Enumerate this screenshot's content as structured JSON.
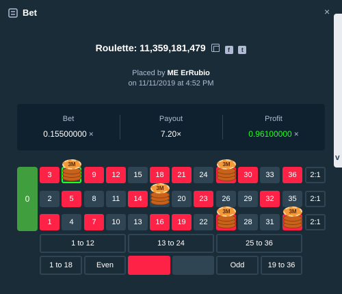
{
  "header": {
    "title": "Bet",
    "close_label": "×"
  },
  "game": {
    "title": "Roulette: 11,359,181,479"
  },
  "placed": {
    "prefix": "Placed by",
    "user": "ME ErRubio",
    "date": "on 11/11/2019 at 4:52 PM"
  },
  "stats": {
    "bet": {
      "label": "Bet",
      "value": "0.15500000",
      "currency_icon": "×"
    },
    "payout": {
      "label": "Payout",
      "value": "7.20×"
    },
    "profit": {
      "label": "Profit",
      "value": "0.96100000",
      "currency_icon": "×"
    }
  },
  "table": {
    "zero": "0",
    "rows": [
      [
        "3",
        "6",
        "9",
        "12",
        "15",
        "18",
        "21",
        "24",
        "27",
        "30",
        "33",
        "36"
      ],
      [
        "2",
        "5",
        "8",
        "11",
        "14",
        "17",
        "20",
        "23",
        "26",
        "29",
        "32",
        "35"
      ],
      [
        "1",
        "4",
        "7",
        "10",
        "13",
        "16",
        "19",
        "22",
        "25",
        "28",
        "31",
        "34"
      ]
    ],
    "column_bets": [
      "2:1",
      "2:1",
      "2:1"
    ],
    "dozens": [
      "1 to 12",
      "13 to 24",
      "25 to 36"
    ],
    "bottom_left": [
      "1 to 18",
      "Even"
    ],
    "bottom_right": [
      "Odd",
      "19 to 36"
    ],
    "chip_label": "3M"
  },
  "colors": {
    "red": "#fe2247",
    "black": "#2f4553",
    "green": "#419e3f",
    "profit": "#1fff20",
    "bg": "#1a2c38"
  }
}
